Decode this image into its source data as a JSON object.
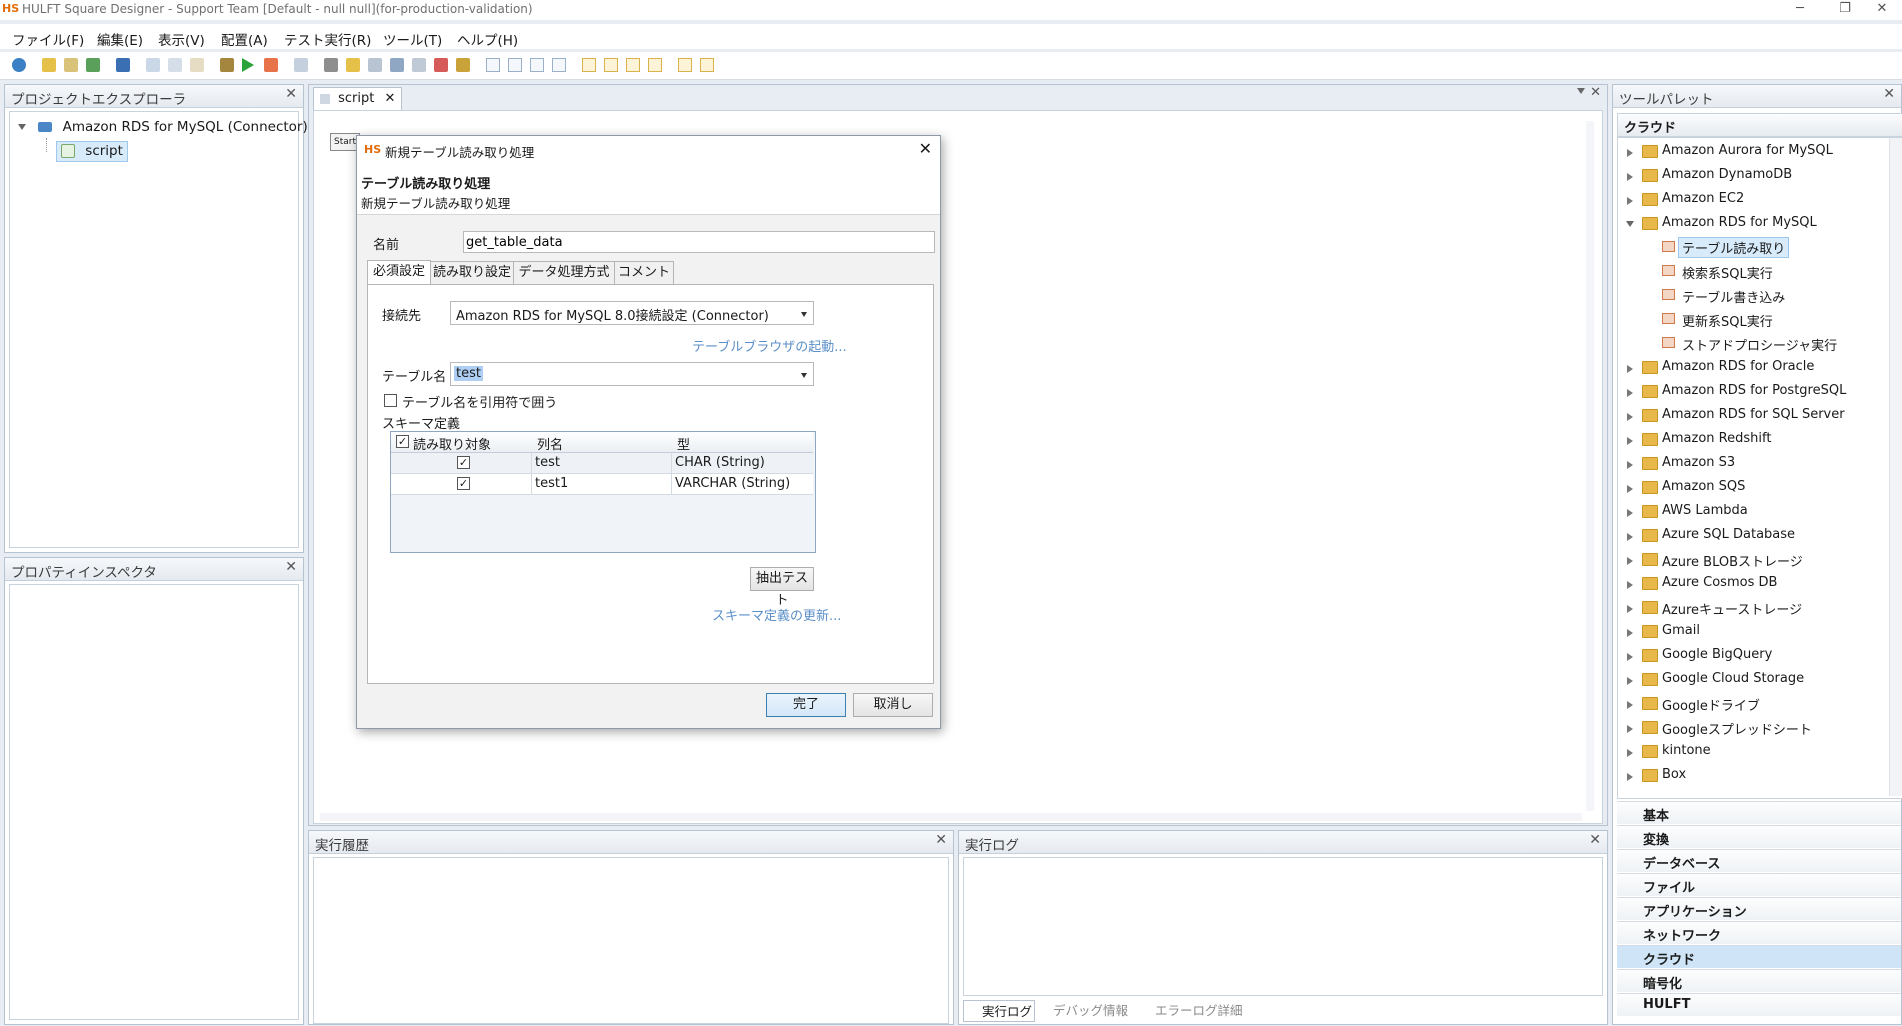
{
  "window": {
    "title": "HULFT Square Designer - Support Team [Default - null null](for-production-validation)",
    "logo": "HS",
    "minimize": "─",
    "restore": "❐",
    "close": "✕"
  },
  "menu": [
    "ファイル(F)",
    "編集(E)",
    "表示(V)",
    "配置(A)",
    "テスト実行(R)",
    "ツール(T)",
    "ヘルプ(H)"
  ],
  "project_explorer": {
    "title": "プロジェクトエクスプローラ",
    "root": "Amazon RDS for MySQL (Connector)",
    "child": "script"
  },
  "property_inspector": {
    "title": "プロパティインスペクタ"
  },
  "editor": {
    "tab": "script",
    "start_label": "Start"
  },
  "history": {
    "title": "実行履歴"
  },
  "exec_log": {
    "title": "実行ログ",
    "bottom_tabs": [
      "実行ログ",
      "デバッグ情報",
      "エラーログ詳細"
    ]
  },
  "palette": {
    "title": "ツールパレット",
    "section": "クラウド",
    "items": [
      {
        "label": "Amazon Aurora for MySQL",
        "kind": "folder"
      },
      {
        "label": "Amazon DynamoDB",
        "kind": "folder"
      },
      {
        "label": "Amazon EC2",
        "kind": "folder"
      },
      {
        "label": "Amazon RDS for MySQL",
        "kind": "folder-open"
      },
      {
        "label": "テーブル読み取り",
        "kind": "op-selected"
      },
      {
        "label": "検索系SQL実行",
        "kind": "op"
      },
      {
        "label": "テーブル書き込み",
        "kind": "op"
      },
      {
        "label": "更新系SQL実行",
        "kind": "op"
      },
      {
        "label": "ストアドプロシージャ実行",
        "kind": "op"
      },
      {
        "label": "Amazon RDS for Oracle",
        "kind": "folder"
      },
      {
        "label": "Amazon RDS for PostgreSQL",
        "kind": "folder"
      },
      {
        "label": "Amazon RDS for SQL Server",
        "kind": "folder"
      },
      {
        "label": "Amazon Redshift",
        "kind": "folder"
      },
      {
        "label": "Amazon S3",
        "kind": "folder"
      },
      {
        "label": "Amazon SQS",
        "kind": "folder"
      },
      {
        "label": "AWS Lambda",
        "kind": "folder"
      },
      {
        "label": "Azure SQL Database",
        "kind": "folder"
      },
      {
        "label": "Azure BLOBストレージ",
        "kind": "folder"
      },
      {
        "label": "Azure Cosmos DB",
        "kind": "folder"
      },
      {
        "label": "Azureキューストレージ",
        "kind": "folder"
      },
      {
        "label": "Gmail",
        "kind": "folder"
      },
      {
        "label": "Google BigQuery",
        "kind": "folder"
      },
      {
        "label": "Google Cloud Storage",
        "kind": "folder"
      },
      {
        "label": "Googleドライブ",
        "kind": "folder"
      },
      {
        "label": "Googleスプレッドシート",
        "kind": "folder"
      },
      {
        "label": "kintone",
        "kind": "folder"
      },
      {
        "label": "Box",
        "kind": "folder"
      }
    ],
    "categories": [
      "基本",
      "変換",
      "データベース",
      "ファイル",
      "アプリケーション",
      "ネットワーク",
      "クラウド",
      "暗号化",
      "HULFT"
    ],
    "selected_category": "クラウド"
  },
  "dialog": {
    "title": "新規テーブル読み取り処理",
    "heading": "テーブル読み取り処理",
    "subheading": "新規テーブル読み取り処理",
    "name_label": "名前",
    "name_value": "get_table_data",
    "tabs": [
      "必須設定",
      "読み取り設定",
      "データ処理方式",
      "コメント"
    ],
    "connection_label": "接続先",
    "connection_value": "Amazon RDS for MySQL 8.0接続設定 (Connector)",
    "table_browser_link": "テーブルブラウザの起動...",
    "table_name_label": "テーブル名",
    "table_name_value": "test",
    "quote_checkbox_label": "テーブル名を引用符で囲う",
    "schema_label": "スキーマ定義",
    "columns": {
      "read": "読み取り対象",
      "name": "列名",
      "type": "型"
    },
    "rows": [
      {
        "name": "test",
        "type": "CHAR (String)"
      },
      {
        "name": "test1",
        "type": "VARCHAR (String)"
      }
    ],
    "extract_test": "抽出テスト",
    "schema_update_link": "スキーマ定義の更新...",
    "ok": "完了",
    "cancel": "取消し",
    "close_glyph": "✕",
    "check_glyph": "✓"
  }
}
